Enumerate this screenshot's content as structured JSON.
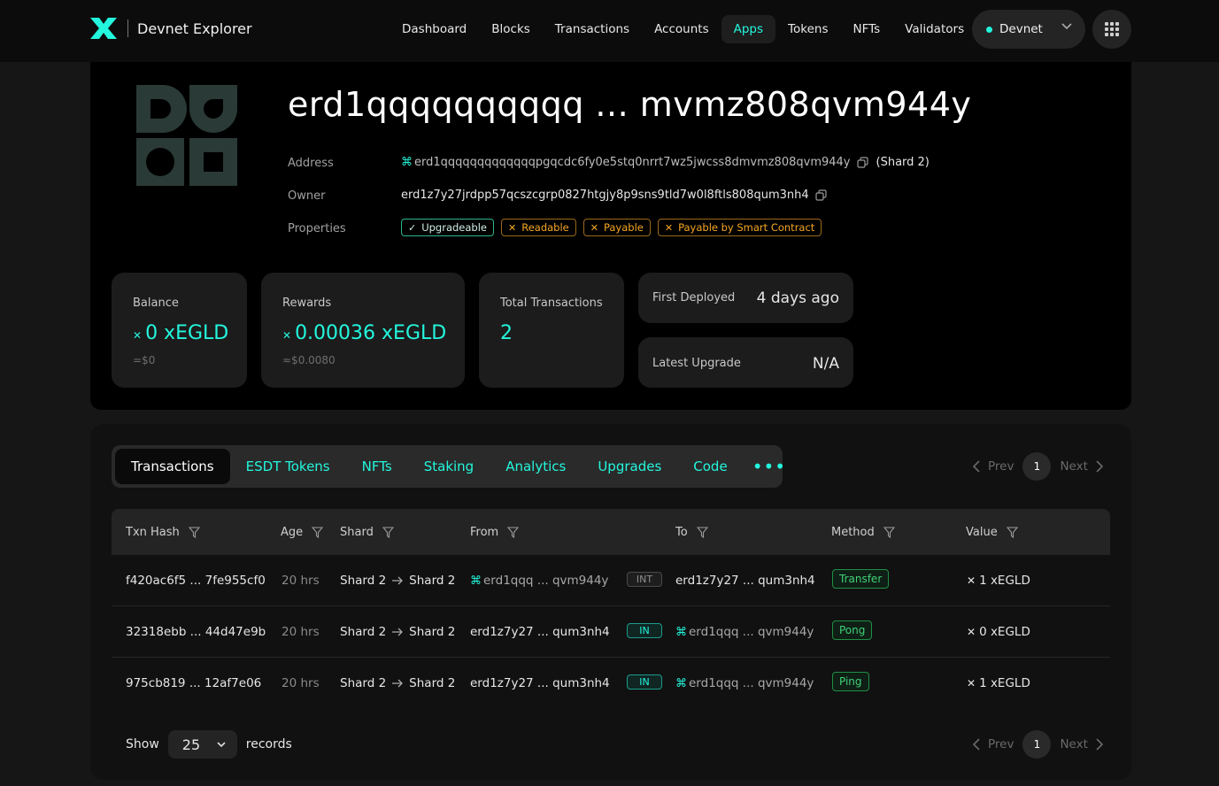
{
  "header": {
    "brand": "Devnet Explorer",
    "nav": [
      "Dashboard",
      "Blocks",
      "Transactions",
      "Accounts",
      "Apps",
      "Tokens",
      "NFTs",
      "Validators"
    ],
    "active_nav": "Apps",
    "network": "Devnet",
    "accent_color": "#23f7dd"
  },
  "account": {
    "title": "erd1qqqqqqqqqq ... mvmz808qvm944y",
    "labels": {
      "address": "Address",
      "owner": "Owner",
      "properties": "Properties"
    },
    "address": "erd1qqqqqqqqqqqqqpgqcdc6fy0e5stq0nrrt7wz5jwcss8dmvmz808qvm944y",
    "shard": "(Shard 2)",
    "owner": "erd1z7y27jrdpp57qcszcgrp0827htgjy8p9sns9tld7w0l8ftls808qum3nh4",
    "properties": [
      {
        "label": "Upgradeable",
        "enabled": true
      },
      {
        "label": "Readable",
        "enabled": false
      },
      {
        "label": "Payable",
        "enabled": false
      },
      {
        "label": "Payable by Smart Contract",
        "enabled": false
      }
    ]
  },
  "stats": {
    "balance": {
      "label": "Balance",
      "value": "0 xEGLD",
      "usd": "=$0"
    },
    "rewards": {
      "label": "Rewards",
      "value": "0.00036 xEGLD",
      "usd": "≈$0.0080"
    },
    "total_tx": {
      "label": "Total Transactions",
      "value": "2"
    },
    "first_deployed": {
      "label": "First Deployed",
      "value": "4 days ago"
    },
    "latest_upgrade": {
      "label": "Latest Upgrade",
      "value": "N/A"
    }
  },
  "tabs": [
    "Transactions",
    "ESDT Tokens",
    "NFTs",
    "Staking",
    "Analytics",
    "Upgrades",
    "Code"
  ],
  "active_tab": "Transactions",
  "pager": {
    "prev": "Prev",
    "page": "1",
    "next": "Next"
  },
  "table": {
    "columns": [
      "Txn Hash",
      "Age",
      "Shard",
      "From",
      "To",
      "Method",
      "Value"
    ],
    "rows": [
      {
        "hash": "f420ac6f5 ... 7fe955cf0",
        "age": "20 hrs",
        "from_shard": "Shard 2",
        "to_shard": "Shard 2",
        "from": "erd1qqq ... qvm944y",
        "from_sc": true,
        "dir": "INT",
        "to": "erd1z7y27 ... qum3nh4",
        "to_sc": false,
        "method": "Transfer",
        "value": "1 xEGLD"
      },
      {
        "hash": "32318ebb ... 44d47e9b",
        "age": "20 hrs",
        "from_shard": "Shard 2",
        "to_shard": "Shard 2",
        "from": "erd1z7y27 ... qum3nh4",
        "from_sc": false,
        "dir": "IN",
        "to": "erd1qqq ... qvm944y",
        "to_sc": true,
        "method": "Pong",
        "value": "0 xEGLD"
      },
      {
        "hash": "975cb819 ... 12af7e06",
        "age": "20 hrs",
        "from_shard": "Shard 2",
        "to_shard": "Shard 2",
        "from": "erd1z7y27 ... qum3nh4",
        "from_sc": false,
        "dir": "IN",
        "to": "erd1qqq ... qvm944y",
        "to_sc": true,
        "method": "Ping",
        "value": "1 xEGLD"
      }
    ]
  },
  "footer": {
    "show": "Show",
    "page_size": "25",
    "records": "records"
  }
}
